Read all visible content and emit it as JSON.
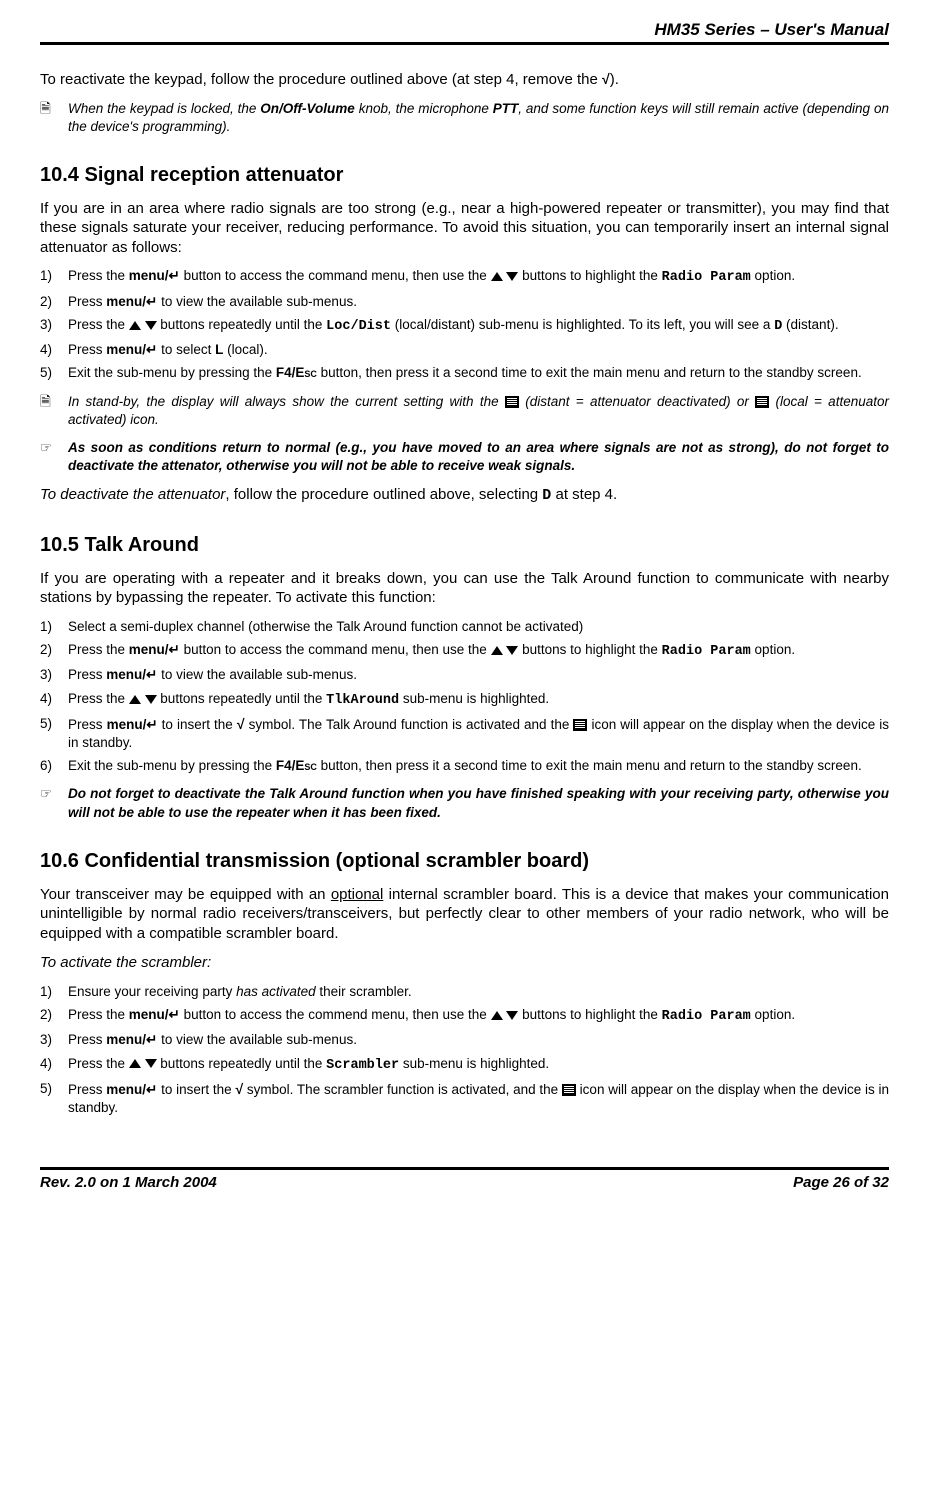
{
  "header": "HM35 Series – User's Manual",
  "intro1_a": "To reactivate the keypad, follow the procedure outlined above (at step 4, remove the ",
  "intro1_b": ").",
  "note1_a": "When the keypad is locked, the ",
  "note1_b": "On/Off-Volume",
  "note1_c": " knob, the microphone ",
  "note1_d": "PTT",
  "note1_e": ", and some function keys will still remain active (depending on the device's programming).",
  "s104": {
    "title": "10.4  Signal reception attenuator",
    "p1": "If you are in an area where radio signals are too strong (e.g., near a high-powered repeater or transmitter), you may find that these signals saturate your receiver, reducing performance.  To avoid this situation, you can temporarily insert an internal signal attenuator as follows:",
    "li1_a": "Press the ",
    "li1_b": "menu/↵",
    "li1_c": " button to access the command menu, then use the ",
    "li1_d": " buttons to highlight the ",
    "li1_e": "Radio Param",
    "li1_f": " option.",
    "li2_a": "Press ",
    "li2_b": "menu/↵",
    "li2_c": " to view the available sub-menus.",
    "li3_a": "Press the ",
    "li3_b": " buttons repeatedly until the ",
    "li3_c": "Loc/Dist",
    "li3_d": " (local/distant) sub-menu is highlighted.  To its left, you will see a ",
    "li3_e": "D",
    "li3_f": " (distant).",
    "li4_a": "Press ",
    "li4_b": "menu/↵",
    "li4_c": " to select ",
    "li4_d": "L",
    "li4_e": " (local).",
    "li5_a": "Exit the sub-menu by pressing the ",
    "li5_b": "F4/E",
    "li5_sc": "sc",
    "li5_c": " button, then press it a second time to exit the main menu and return to the standby screen.",
    "note_a": "In stand-by, the display will always show the current setting with the ",
    "note_b": " (distant = attenuator deactivated) or  ",
    "note_c": " (local = attenuator activated) icon.",
    "warn": "As soon as conditions return to normal (e.g., you have moved to an area where signals are not as strong), do not forget to deactivate the attenator, otherwise you will not be able to receive weak signals.",
    "p2_a": "To deactivate the attenuator",
    "p2_b": ", follow the procedure outlined above, selecting ",
    "p2_c": "D",
    "p2_d": " at step 4."
  },
  "s105": {
    "title": "10.5  Talk Around",
    "p1": "If you are operating with a repeater and it breaks down, you can use the Talk Around function to communicate with nearby stations by bypassing the repeater.  To activate this function:",
    "li1": "Select a semi-duplex channel (otherwise the Talk Around function cannot be activated)",
    "li2_a": "Press the ",
    "li2_b": "menu/↵",
    "li2_c": " button to access the command menu, then use the ",
    "li2_d": " buttons to highlight the ",
    "li2_e": "Radio Param",
    "li2_f": " option.",
    "li3_a": "Press ",
    "li3_b": "menu/↵",
    "li3_c": " to view the available sub-menus.",
    "li4_a": "Press the ",
    "li4_b": " buttons repeatedly until the ",
    "li4_c": "TlkAround",
    "li4_d": " sub-menu is highlighted.",
    "li5_a": "Press ",
    "li5_b": "menu/↵",
    "li5_c": " to insert the ",
    "li5_d": " symbol.  The Talk Around function is activated and the ",
    "li5_e": " icon will appear on the display when the device is in standby.",
    "li6_a": "Exit the sub-menu by pressing the ",
    "li6_b": "F4/E",
    "li6_sc": "sc",
    "li6_c": " button, then press it a second time to exit the main menu and return to the standby screen.",
    "warn": "Do not forget to deactivate the Talk Around function when you have finished speaking with your receiving party, otherwise you will not be able to use the repeater when it has been fixed."
  },
  "s106": {
    "title": "10.6  Confidential transmission (optional scrambler board)",
    "p1_a": "Your transceiver may be equipped with an ",
    "p1_u": "optional",
    "p1_b": " internal scrambler board.  This is a device that makes your communication unintelligible by normal radio receivers/transceivers, but perfectly clear to other members of your radio network, who will be equipped with a compatible scrambler board.",
    "p2": "To activate the scrambler",
    "li1_a": "Ensure your receiving party ",
    "li1_i": "has activated",
    "li1_b": " their scrambler.",
    "li2_a": "Press the ",
    "li2_b": "menu/↵",
    "li2_c": " button to access the commend menu, then use the ",
    "li2_d": " buttons to highlight the ",
    "li2_e": "Radio Param",
    "li2_f": " option.",
    "li3_a": "Press ",
    "li3_b": "menu/↵",
    "li3_c": " to view the available sub-menus.",
    "li4_a": "Press the ",
    "li4_b": " buttons repeatedly until the ",
    "li4_c": "Scrambler",
    "li4_d": " sub-menu is highlighted.",
    "li5_a": "Press ",
    "li5_b": "menu/↵",
    "li5_c": " to insert the ",
    "li5_d": " symbol.  The scrambler function is activated, and the ",
    "li5_e": " icon will appear on the display when the device is in standby."
  },
  "footer": {
    "left": "Rev. 2.0 on 1 March 2004",
    "right": "Page 26 of 32"
  },
  "nums": {
    "n1": "1)",
    "n2": "2)",
    "n3": "3)",
    "n4": "4)",
    "n5": "5)",
    "n6": "6)"
  },
  "check": "√",
  "note_glyph": "🗎",
  "hand_glyph": "☞"
}
